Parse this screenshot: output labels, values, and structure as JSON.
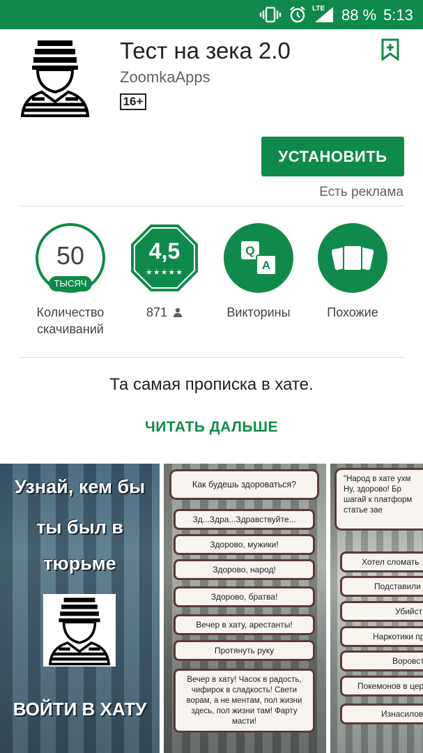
{
  "status_bar": {
    "battery_text": "88 %",
    "time": "5:13",
    "network_label": "LTE",
    "icons": [
      "vibrate-icon",
      "alarm-icon",
      "signal-icon",
      "battery-icon"
    ]
  },
  "app": {
    "title": "Тест на зека 2.0",
    "developer": "ZoomkaApps",
    "age_rating": "16+",
    "install_label": "УСТАНОВИТЬ",
    "ads_note": "Есть реклама"
  },
  "stats": {
    "downloads": {
      "value": "50",
      "unit": "ТЫСЯЧ",
      "label_line1": "Количество",
      "label_line2": "скачиваний"
    },
    "rating": {
      "value": "4,5",
      "stars": 4.5,
      "count": "871"
    },
    "category": {
      "label": "Викторины"
    },
    "similar": {
      "label": "Похожие"
    }
  },
  "description": "Та самая прописка в хате.",
  "read_more": "ЧИТАТЬ ДАЛЬШЕ",
  "screenshots": {
    "shot1": {
      "line1": "Узнай, кем бы",
      "line2": "ты был в",
      "line3": "тюрьме",
      "enter": "ВОЙТИ В ХАТУ"
    },
    "shot2": {
      "question": "Как будешь здороваться?",
      "answers": [
        "Зд...Здра...Здравствуйте...",
        "Здорово, мужики!",
        "Здорово, народ!",
        "Здорово, братва!",
        "Вечер в хату, арестанты!",
        "Протянуть руку"
      ],
      "long_answer": "Вечер в хату! Часок в радость, чифирок в сладкость! Свети ворам, а не ментам, пол жизни здесь, пол жизни там! Фарту масти!"
    },
    "shot3": {
      "question_lines": [
        "\"Народ в хате ухм",
        "Ну, здорово! Бр",
        "шагай к платформ",
        "статье зае"
      ],
      "answers": [
        "Хотел сломать",
        "Подставили",
        "Убийст",
        "Наркотики пр",
        "Воровст",
        "Покемонов в цер",
        "Изнасилов"
      ]
    }
  },
  "colors": {
    "accent": "#0f8a4a",
    "status_bar": "#0f8a4a"
  }
}
